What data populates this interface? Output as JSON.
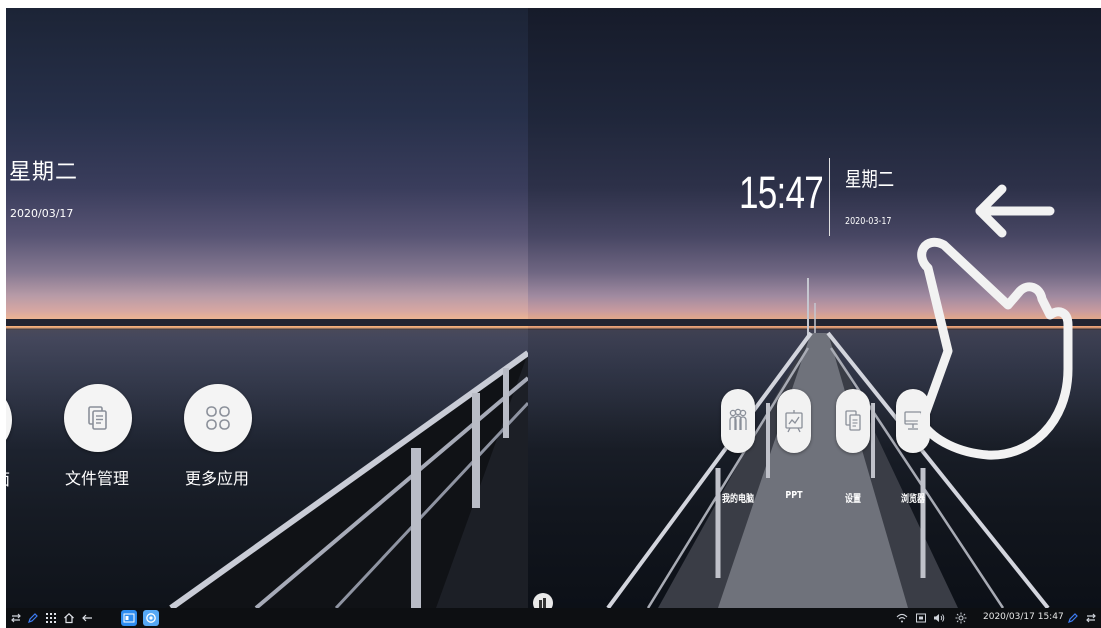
{
  "left_panel": {
    "weekday": "星期二",
    "date": "2020/03/17",
    "apps": [
      {
        "label": "面",
        "icon": "partial-app-icon"
      },
      {
        "label": "文件管理",
        "icon": "file-manager-icon"
      },
      {
        "label": "更多应用",
        "icon": "more-apps-icon"
      }
    ]
  },
  "right_panel": {
    "time": "15:47",
    "weekday": "星期二",
    "date": "2020-03-17",
    "apps": [
      {
        "label": "我的电脑",
        "icon": "people-icon"
      },
      {
        "label": "PPT",
        "icon": "whiteboard-icon"
      },
      {
        "label": "设置",
        "icon": "files-icon"
      },
      {
        "label": "浏览器",
        "icon": "monitor-icon"
      }
    ],
    "gesture_hint": {
      "direction": "left",
      "icon": "swipe-left-hand-icon"
    }
  },
  "taskbar": {
    "left_icons": [
      "swap-icon",
      "pen-icon",
      "apps-grid-icon",
      "home-icon",
      "back-icon"
    ],
    "pinned_apps": [
      "window-app-icon",
      "browser-app-icon"
    ],
    "right_icons": [
      "wifi-icon",
      "screen-icon",
      "volume-icon",
      "brightness-icon",
      "pen-icon",
      "swap-icon"
    ],
    "datetime": "2020/03/17  15:47"
  },
  "colors": {
    "taskbar": "#0d0f12",
    "button_bg": "#f4f4f4",
    "pen_blue": "#3e7cf3",
    "app_blue": "#2d8cf0"
  }
}
